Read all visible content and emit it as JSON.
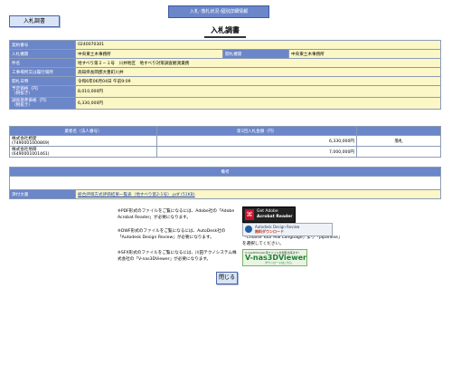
{
  "header": {
    "topbar": "入札･落札状況-個別詳細情報",
    "tag_button": "入札調書",
    "title": "入札調書"
  },
  "info": [
    {
      "label": "契約番号",
      "value": "0240070301"
    },
    {
      "label": "入札機関",
      "value": "中央東土木事務所",
      "label2": "開札機関",
      "value2": "中央東土木事務所"
    },
    {
      "label": "件名",
      "value": "地すべり第２－１号　川井地区　地すべり対策調査観測業務"
    },
    {
      "label": "工事場所又は履行場所",
      "value": "高知県長岡郡大豊町川井"
    },
    {
      "label": "開札日時",
      "value": "令和6年06月04日 午前9:09"
    },
    {
      "label": "予定価格（円）\n（税抜き）",
      "value": "8,010,000円"
    },
    {
      "label": "調査基準価格（円）\n（税抜き）",
      "value": "6,330,000円"
    }
  ],
  "bids": {
    "headers": [
      "業者名（法人番号）",
      "第1回入札金額（円）",
      ""
    ],
    "rows": [
      {
        "name": "株式会社相愛",
        "number": "(7490001000869)",
        "amount": "6,330,000円",
        "result": "落札"
      },
      {
        "name": "株式会社地研",
        "number": "(6490001001461)",
        "amount": "7,000,000円",
        "result": ""
      }
    ]
  },
  "remarks": {
    "header": "備考",
    "attach_label": "添付文書",
    "attach_link": "総合評価方式評価結果一覧表（地すべり第2-1号）.pdf (51KB)"
  },
  "notes": {
    "pdf": "※PDF形式のファイルをご覧になるには、Adobe社の「Adobe Acrobat Reader」が必要になります。",
    "dwf": "※DWF形式のファイルをご覧になるには、AutoDesk社の「Autodesk Design Review」が必要になります。",
    "dwf_lang": "「Choose Your MSI Language」より「Japanese」を選択してください。",
    "sfx": "※SFX形式のファイルをご覧になるには、川田テクノシステム株式会社の「V-nas3DViewer」が必要になります。"
  },
  "badges": {
    "acrobat_a": "Get Adobe",
    "acrobat_b": "Acrobat Reader",
    "autodesk_a": "Autodesk Design Review",
    "autodesk_b": "無料ダウンロード",
    "vnas_a": "V-nas3DViewer用ファイルを閲覧出来ます！",
    "vnas_b": "V-nas3DViewer",
    "vnas_c": "ダウンロードはこちら"
  },
  "close_button": "閉じる"
}
